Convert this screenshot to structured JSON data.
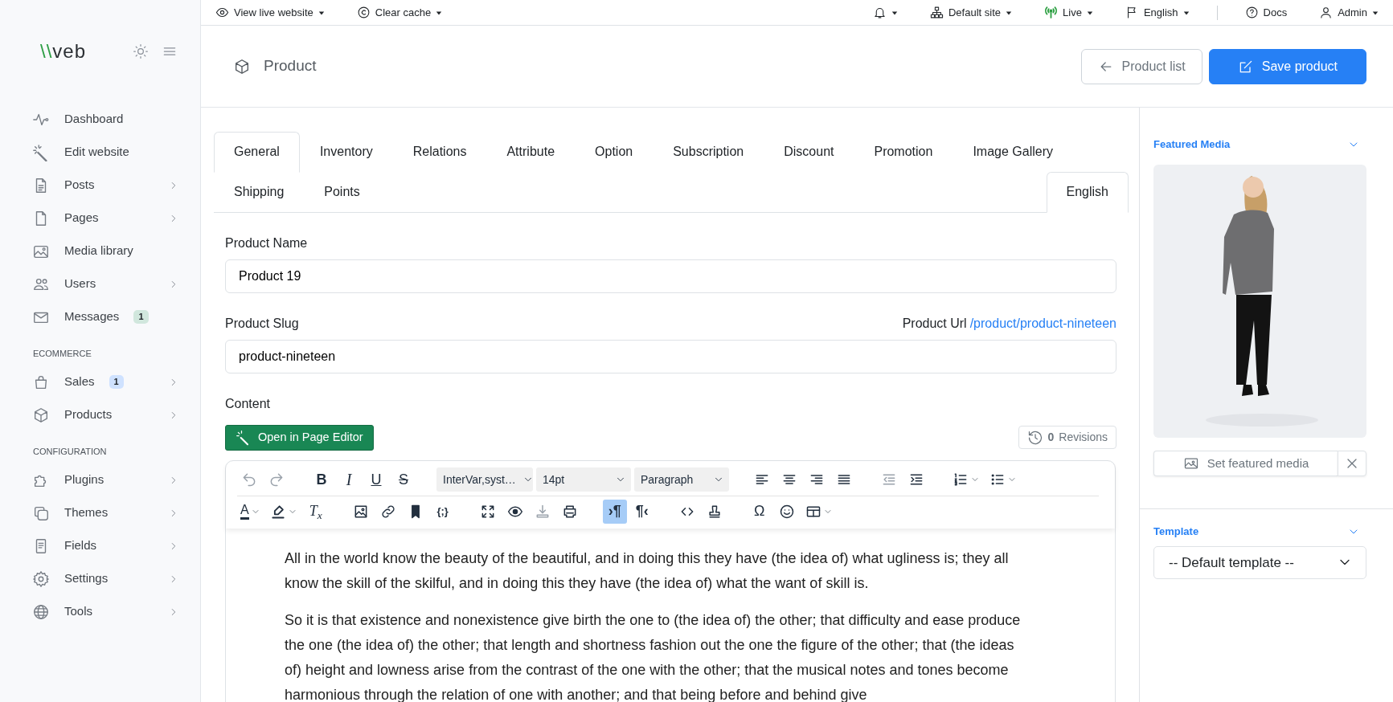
{
  "logo": {
    "parts": [
      {
        "text": "\\\\",
        "color": "#2e9e45"
      },
      {
        "text": "veb",
        "color": "#2b2f33"
      }
    ]
  },
  "sidebar": {
    "sections": [
      {
        "items": [
          {
            "label": "Dashboard",
            "expandable": false
          },
          {
            "label": "Edit website",
            "expandable": false
          },
          {
            "label": "Posts",
            "expandable": true
          },
          {
            "label": "Pages",
            "expandable": true
          },
          {
            "label": "Media library",
            "expandable": false
          },
          {
            "label": "Users",
            "expandable": true
          },
          {
            "label": "Messages",
            "expandable": false,
            "badge": "1",
            "color": "#d1e7dd"
          }
        ]
      },
      {
        "heading": "ECOMMERCE",
        "items": [
          {
            "label": "Sales",
            "expandable": true,
            "badge": "1",
            "color": "#cfe2ff"
          },
          {
            "label": "Products",
            "expandable": true
          }
        ]
      },
      {
        "heading": "CONFIGURATION",
        "items": [
          {
            "label": "Plugins",
            "expandable": true
          },
          {
            "label": "Themes",
            "expandable": true
          },
          {
            "label": "Fields",
            "expandable": true
          },
          {
            "label": "Settings",
            "expandable": true
          },
          {
            "label": "Tools",
            "expandable": true
          }
        ]
      }
    ]
  },
  "top_bar": {
    "left": [
      {
        "label": "View live website",
        "menu": true
      },
      {
        "label": "Clear cache",
        "menu": true
      }
    ],
    "right": [
      {
        "menu": true
      },
      {
        "label": "Default site",
        "menu": true
      },
      {
        "label": "Live",
        "menu": true,
        "color": "#2ea043"
      },
      {
        "label": "English",
        "menu": true
      },
      {
        "label": "Docs",
        "menu": false,
        "divider_before": true
      },
      {
        "label": "Admin",
        "menu": true
      }
    ]
  },
  "header": {
    "title": "Product",
    "buttons": [
      {
        "label": "Product list",
        "kind": "outline"
      },
      {
        "label": "Save product",
        "kind": "primary"
      }
    ]
  },
  "tabs": [
    {
      "label": "General",
      "selected": true
    },
    {
      "label": "Inventory",
      "selected": false
    },
    {
      "label": "Relations",
      "selected": false
    },
    {
      "label": "Attribute",
      "selected": false
    },
    {
      "label": "Option",
      "selected": false
    },
    {
      "label": "Subscription",
      "selected": false
    },
    {
      "label": "Discount",
      "selected": false
    },
    {
      "label": "Promotion",
      "selected": false
    },
    {
      "label": "Image Gallery",
      "selected": false
    },
    {
      "label": "Shipping",
      "selected": false
    },
    {
      "label": "Points",
      "selected": false
    }
  ],
  "language_tabs": [
    {
      "label": "English",
      "selected": true
    }
  ],
  "form": {
    "fields": [
      {
        "label": "Product Name",
        "value": "Product 19"
      },
      {
        "label": "Product Slug",
        "value": "product-nineteen",
        "url_label": "Product Url",
        "url": "/product/product-nineteen"
      }
    ],
    "content_label": "Content",
    "editor_button": "Open in Page Editor",
    "revisions": {
      "count": "0",
      "label": "Revisions"
    }
  },
  "editor": {
    "toolbar": [
      [
        [
          {
            "kind": "icon",
            "disabled": true,
            "active": false
          },
          {
            "kind": "icon",
            "disabled": true,
            "active": false
          }
        ],
        [
          {
            "kind": "glyph",
            "text": "B",
            "disabled": false,
            "active": false
          },
          {
            "kind": "glyph",
            "text": "I",
            "disabled": false,
            "active": false
          },
          {
            "kind": "glyph",
            "text": "U",
            "disabled": false,
            "active": false
          },
          {
            "kind": "glyph",
            "text": "S",
            "disabled": false,
            "active": false
          }
        ],
        [
          {
            "kind": "select",
            "value": "InterVar,syst…"
          },
          {
            "kind": "select",
            "value": "14pt"
          },
          {
            "kind": "select",
            "value": "Paragraph"
          }
        ],
        [
          {
            "kind": "icon",
            "disabled": false,
            "active": false
          },
          {
            "kind": "icon",
            "disabled": false,
            "active": false
          },
          {
            "kind": "icon",
            "disabled": false,
            "active": false
          },
          {
            "kind": "icon",
            "disabled": false,
            "active": false
          }
        ],
        [
          {
            "kind": "icon",
            "disabled": true,
            "active": false
          },
          {
            "kind": "icon",
            "disabled": false,
            "active": false
          }
        ],
        [
          {
            "kind": "icon",
            "disabled": false,
            "active": false,
            "menu": true
          },
          {
            "kind": "icon",
            "disabled": false,
            "active": false,
            "menu": true
          }
        ]
      ],
      [
        [
          {
            "kind": "glyph",
            "text": "A",
            "disabled": false,
            "active": false,
            "menu": true
          },
          {
            "kind": "icon",
            "disabled": false,
            "active": false,
            "menu": true
          },
          {
            "kind": "glyph",
            "text": "T$_{x}$",
            "disabled": false,
            "active": false
          }
        ],
        [
          {
            "kind": "icon",
            "disabled": false,
            "active": false
          },
          {
            "kind": "icon",
            "disabled": false,
            "active": false
          },
          {
            "kind": "icon",
            "disabled": false,
            "active": false
          },
          {
            "kind": "glyph",
            "text": "{;}",
            "disabled": false,
            "active": false
          }
        ],
        [
          {
            "kind": "icon",
            "disabled": false,
            "active": false
          },
          {
            "kind": "icon",
            "disabled": false,
            "active": false
          },
          {
            "kind": "icon",
            "disabled": true,
            "active": false
          },
          {
            "kind": "icon",
            "disabled": false,
            "active": false
          }
        ],
        [
          {
            "kind": "glyph",
            "text": "›¶",
            "disabled": false,
            "active": true
          },
          {
            "kind": "glyph",
            "text": "¶‹",
            "disabled": false,
            "active": false
          }
        ],
        [
          {
            "kind": "icon",
            "disabled": false,
            "active": false
          },
          {
            "kind": "icon",
            "disabled": false,
            "active": false
          }
        ],
        [
          {
            "kind": "glyph",
            "text": "Ω",
            "disabled": false,
            "active": false
          },
          {
            "kind": "icon",
            "disabled": false,
            "active": false
          },
          {
            "kind": "icon",
            "disabled": false,
            "active": false,
            "menu": true
          }
        ]
      ]
    ],
    "paragraphs": [
      "All in the world know the beauty of the beautiful, and in doing this they have (the idea of) what ugliness is; they all know the skill of the skilful, and in doing this they have (the idea of) what the want of skill is.",
      "So it is that existence and nonexistence give birth the one to (the idea of) the other; that difficulty and ease produce the one (the idea of) the other; that length and shortness fashion out the one the figure of the other; that (the ideas of) height and lowness arise from the contrast of the one with the other; that the musical notes and tones become harmonious through the relation of one with another; and that being before and behind give"
    ]
  },
  "featured_media": {
    "title": "Featured Media",
    "expanded": true,
    "button": "Set featured media"
  },
  "template": {
    "title": "Template",
    "expanded": true,
    "value": "-- Default template --"
  }
}
